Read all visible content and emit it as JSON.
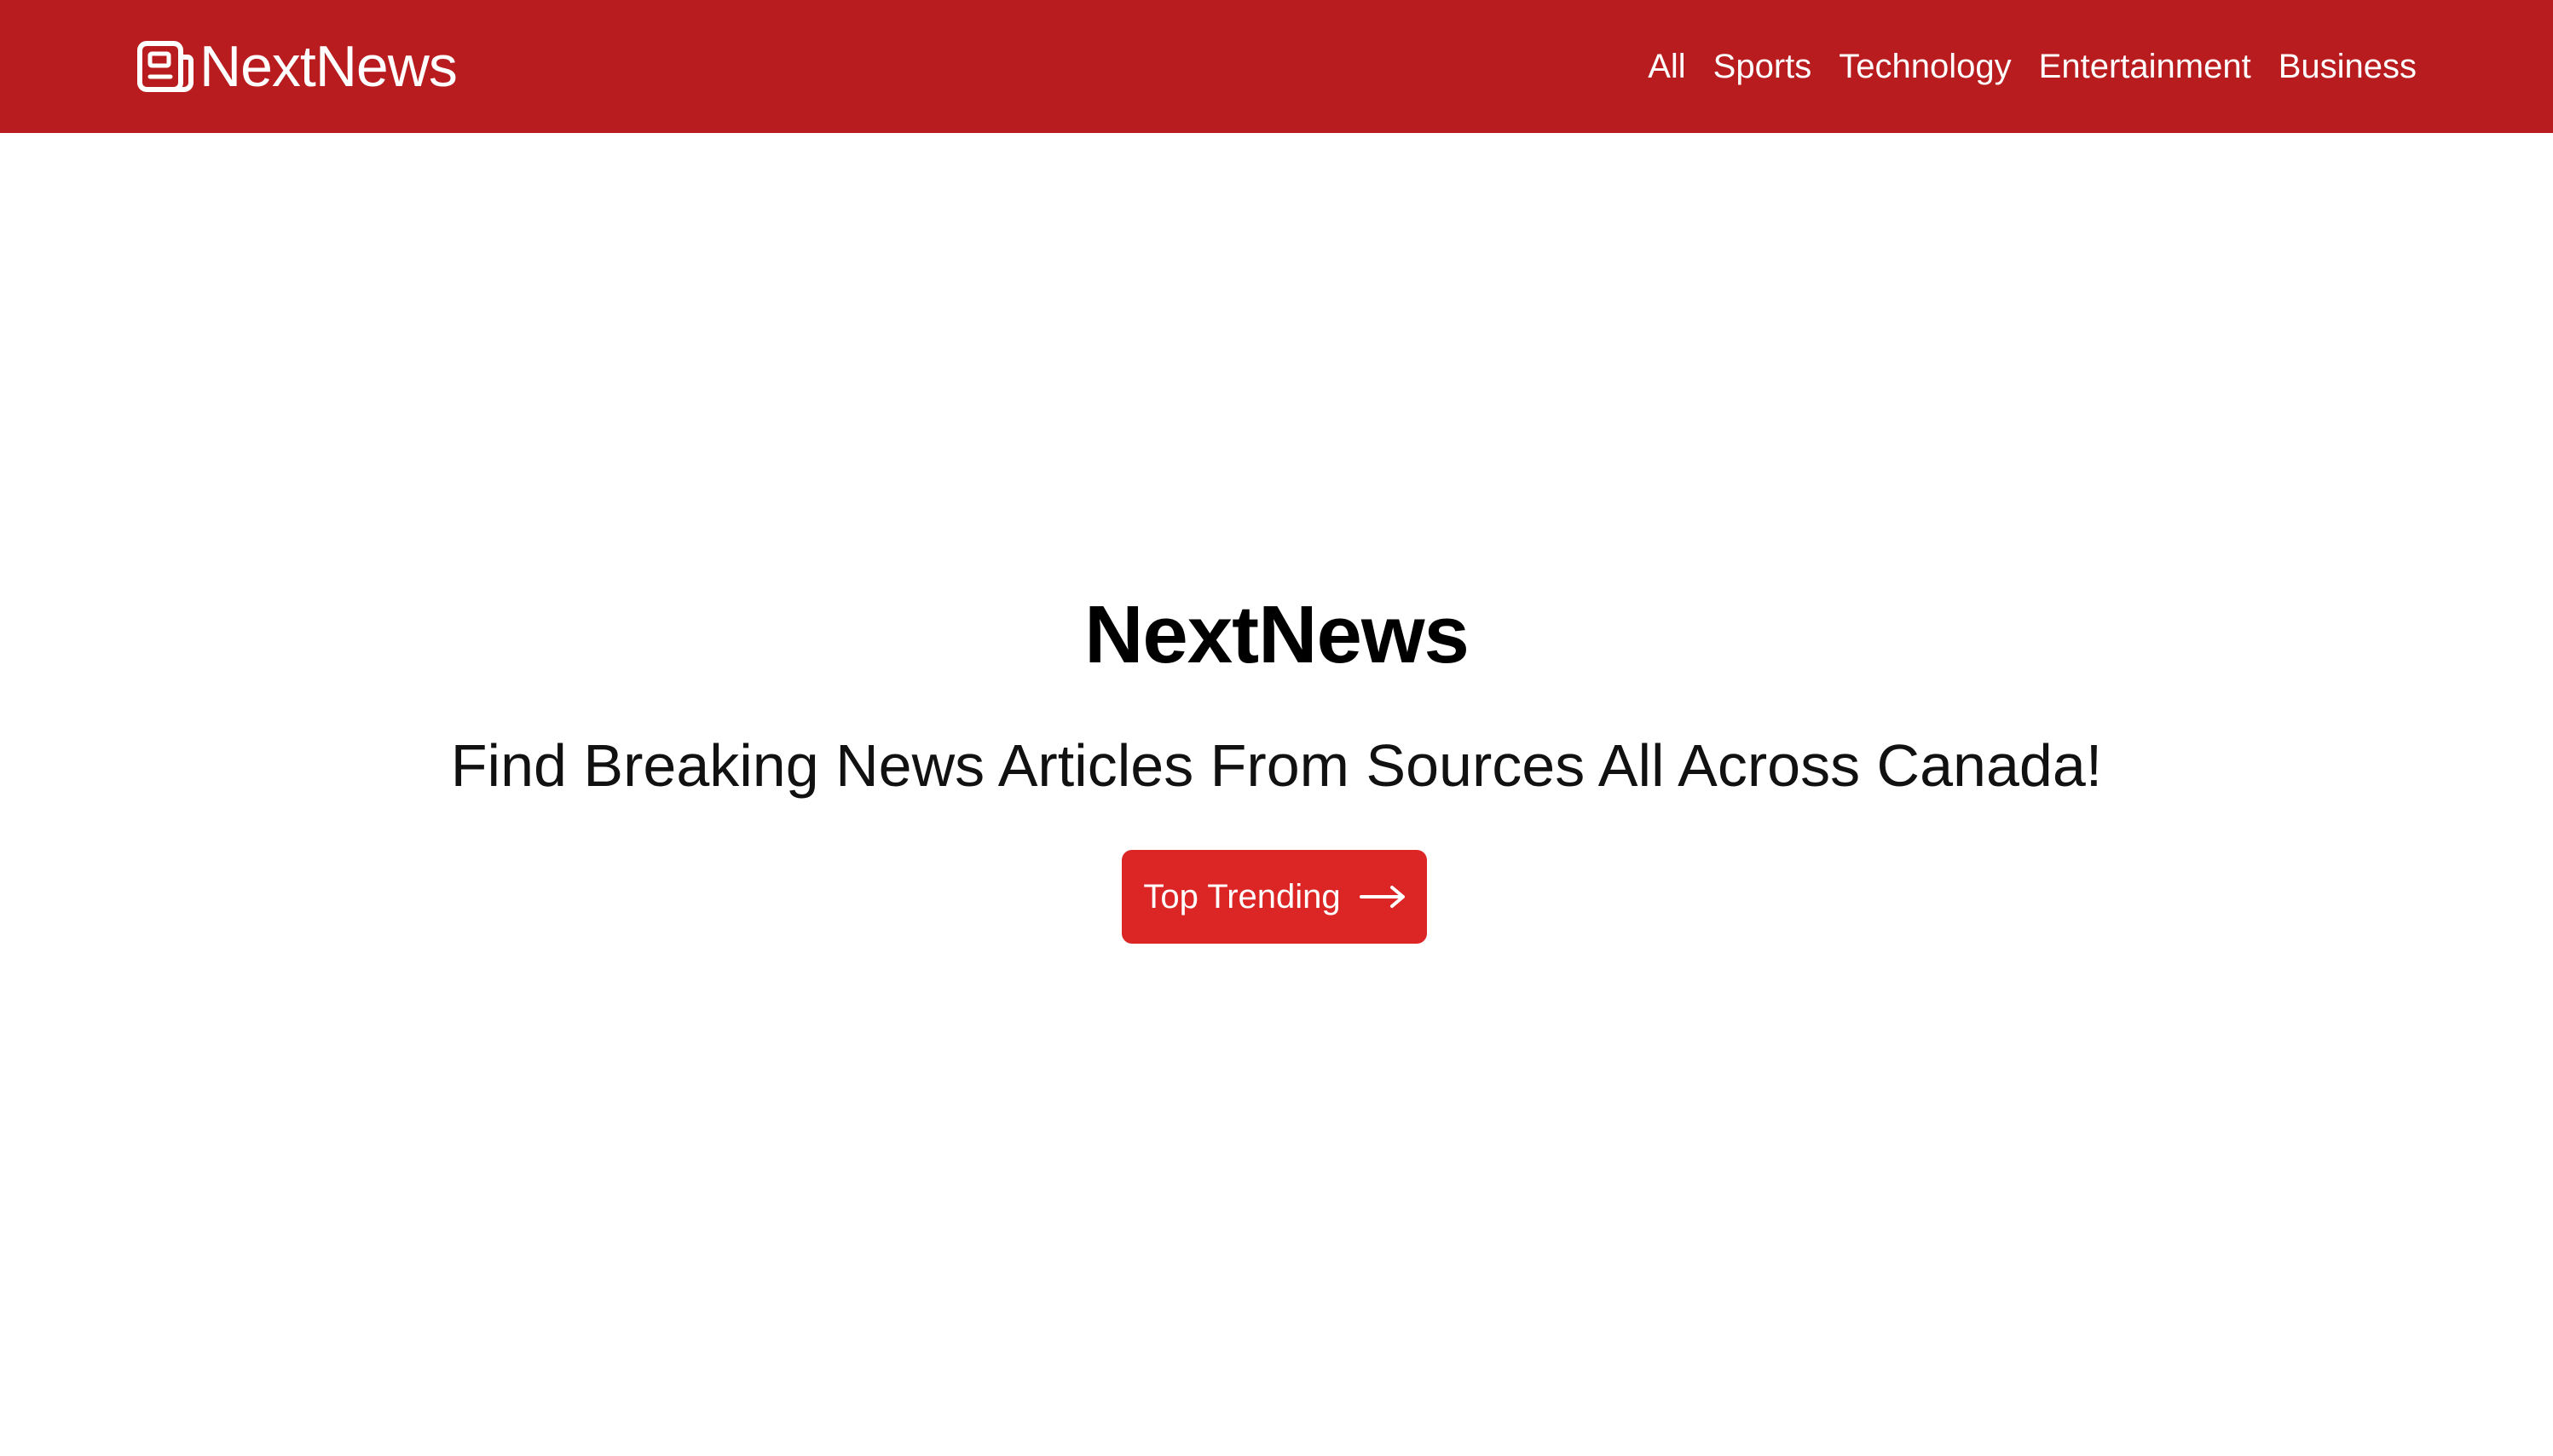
{
  "nav": {
    "brand": "NextNews",
    "brand_icon": "newspaper-icon",
    "links": [
      "All",
      "Sports",
      "Technology",
      "Entertainment",
      "Business"
    ]
  },
  "hero": {
    "title": "NextNews",
    "subtitle": "Find Breaking News Articles From Sources All Across Canada!",
    "button_label": "Top Trending",
    "button_icon": "arrow-right-icon"
  },
  "colors": {
    "navbar": "#b91c1f",
    "button": "#dc2626",
    "text": "#000000",
    "background": "#ffffff"
  }
}
